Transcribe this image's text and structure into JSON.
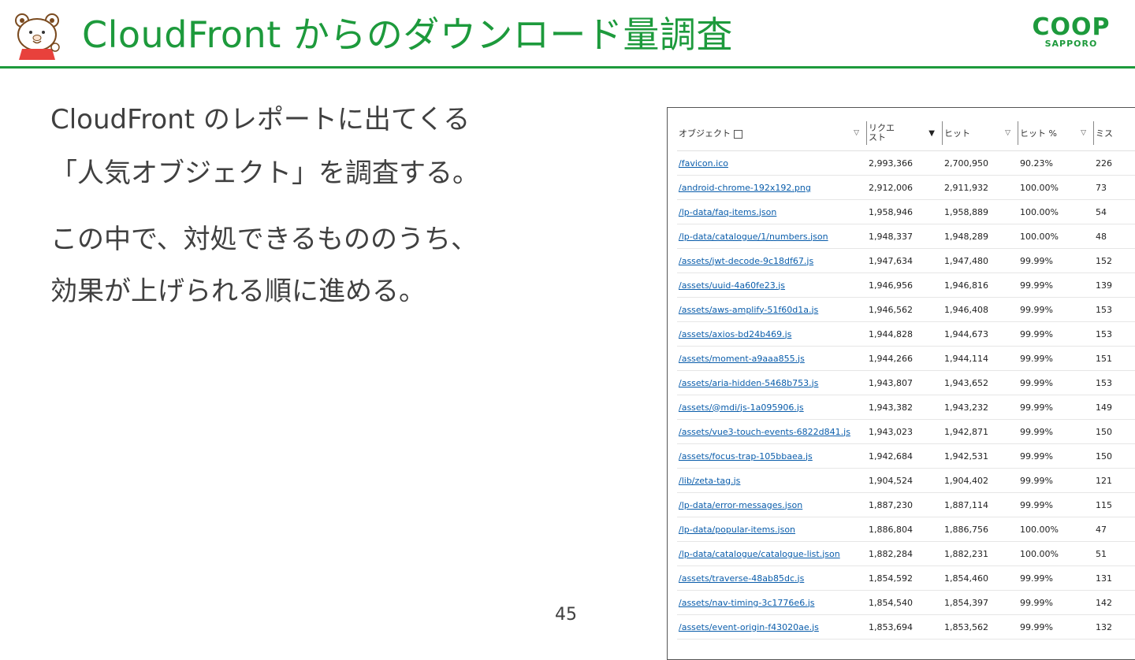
{
  "header": {
    "title": "CloudFront からのダウンロード量調査",
    "logo_main": "COOP",
    "logo_sub": "SAPPORO"
  },
  "body": {
    "line1": "CloudFront のレポートに出てくる",
    "line2": "「人気オブジェクト」を調査する。",
    "line3": "この中で、対処できるもののうち、",
    "line4": "効果が上げられる順に進める。"
  },
  "page_number": "45",
  "table": {
    "headers": [
      "オブジェクト",
      "リクエスト",
      "ヒット",
      "ヒット %",
      "ミス"
    ],
    "rows": [
      [
        "/favicon.ico",
        "2,993,366",
        "2,700,950",
        "90.23%",
        "226"
      ],
      [
        "/android-chrome-192x192.png",
        "2,912,006",
        "2,911,932",
        "100.00%",
        "73"
      ],
      [
        "/lp-data/faq-items.json",
        "1,958,946",
        "1,958,889",
        "100.00%",
        "54"
      ],
      [
        "/lp-data/catalogue/1/numbers.json",
        "1,948,337",
        "1,948,289",
        "100.00%",
        "48"
      ],
      [
        "/assets/jwt-decode-9c18df67.js",
        "1,947,634",
        "1,947,480",
        "99.99%",
        "152"
      ],
      [
        "/assets/uuid-4a60fe23.js",
        "1,946,956",
        "1,946,816",
        "99.99%",
        "139"
      ],
      [
        "/assets/aws-amplify-51f60d1a.js",
        "1,946,562",
        "1,946,408",
        "99.99%",
        "153"
      ],
      [
        "/assets/axios-bd24b469.js",
        "1,944,828",
        "1,944,673",
        "99.99%",
        "153"
      ],
      [
        "/assets/moment-a9aaa855.js",
        "1,944,266",
        "1,944,114",
        "99.99%",
        "151"
      ],
      [
        "/assets/aria-hidden-5468b753.js",
        "1,943,807",
        "1,943,652",
        "99.99%",
        "153"
      ],
      [
        "/assets/@mdi/js-1a095906.js",
        "1,943,382",
        "1,943,232",
        "99.99%",
        "149"
      ],
      [
        "/assets/vue3-touch-events-6822d841.js",
        "1,943,023",
        "1,942,871",
        "99.99%",
        "150"
      ],
      [
        "/assets/focus-trap-105bbaea.js",
        "1,942,684",
        "1,942,531",
        "99.99%",
        "150"
      ],
      [
        "/lib/zeta-tag.js",
        "1,904,524",
        "1,904,402",
        "99.99%",
        "121"
      ],
      [
        "/lp-data/error-messages.json",
        "1,887,230",
        "1,887,114",
        "99.99%",
        "115"
      ],
      [
        "/lp-data/popular-items.json",
        "1,886,804",
        "1,886,756",
        "100.00%",
        "47"
      ],
      [
        "/lp-data/catalogue/catalogue-list.json",
        "1,882,284",
        "1,882,231",
        "100.00%",
        "51"
      ],
      [
        "/assets/traverse-48ab85dc.js",
        "1,854,592",
        "1,854,460",
        "99.99%",
        "131"
      ],
      [
        "/assets/nav-timing-3c1776e6.js",
        "1,854,540",
        "1,854,397",
        "99.99%",
        "142"
      ],
      [
        "/assets/event-origin-f43020ae.js",
        "1,853,694",
        "1,853,562",
        "99.99%",
        "132"
      ]
    ]
  },
  "colors": {
    "accent": "#1d9a3c",
    "link": "#0a5dab",
    "text": "#404040"
  },
  "icons": {
    "mascot": "bear-mascot-icon",
    "external": "external-link-icon",
    "sort": "sort-caret-icon"
  }
}
